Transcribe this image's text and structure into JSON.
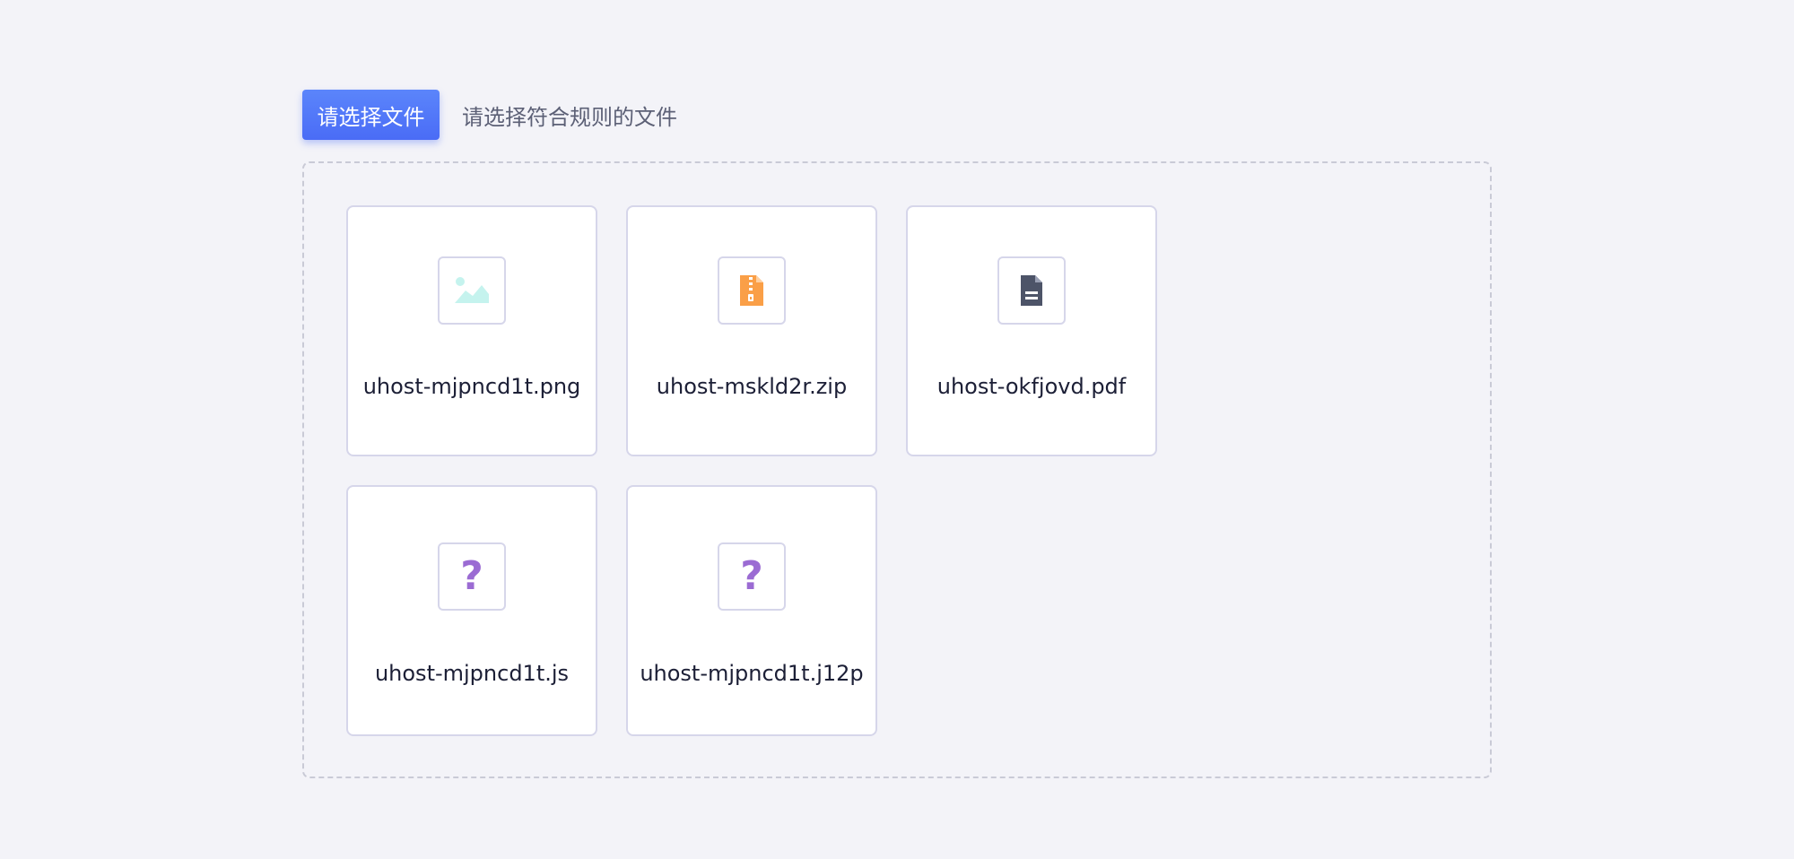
{
  "toolbar": {
    "select_button_label": "请选择文件",
    "hint": "请选择符合规则的文件"
  },
  "files": [
    {
      "name": "uhost-mjpncd1t.png",
      "icon": "image-icon",
      "icon_color": "#c5f3ee"
    },
    {
      "name": "uhost-mskld2r.zip",
      "icon": "zip-file-icon",
      "icon_color": "#fa9f47"
    },
    {
      "name": "uhost-okfjovd.pdf",
      "icon": "document-icon",
      "icon_color": "#4d5468"
    },
    {
      "name": "uhost-mjpncd1t.js",
      "icon": "unknown-file-icon",
      "icon_color": "#9b6bd3",
      "glyph": "?"
    },
    {
      "name": "uhost-mjpncd1t.j12p",
      "icon": "unknown-file-icon",
      "icon_color": "#9b6bd3",
      "glyph": "?"
    }
  ],
  "colors": {
    "accent": "#4a6cf6",
    "background": "#f3f3f8",
    "card_border": "#d6d6ea"
  }
}
